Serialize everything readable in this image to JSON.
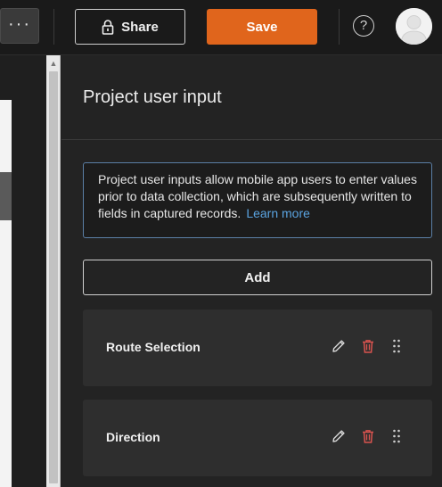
{
  "toolbar": {
    "more_label": "···",
    "share_label": "Share",
    "save_label": "Save",
    "help_label": "?",
    "save_color": "#e0651c"
  },
  "panel": {
    "title": "Project user input",
    "info_text": "Project user inputs allow mobile app users to enter values prior to data collection, which are subsequently written to fields in captured records.",
    "learn_more": "Learn more",
    "add_label": "Add",
    "items": [
      {
        "label": "Route Selection"
      },
      {
        "label": "Direction"
      }
    ]
  },
  "icons": {
    "more": "more-horizontal-icon",
    "share": "lock-icon",
    "help": "help-circle-icon",
    "avatar": "user-avatar-icon",
    "edit": "pencil-icon",
    "delete": "trash-icon",
    "drag": "drag-handle-icon"
  },
  "colors": {
    "accent": "#e0651c",
    "link": "#5aa3e0",
    "delete": "#d9534f",
    "info_border": "#5b7fa6"
  }
}
